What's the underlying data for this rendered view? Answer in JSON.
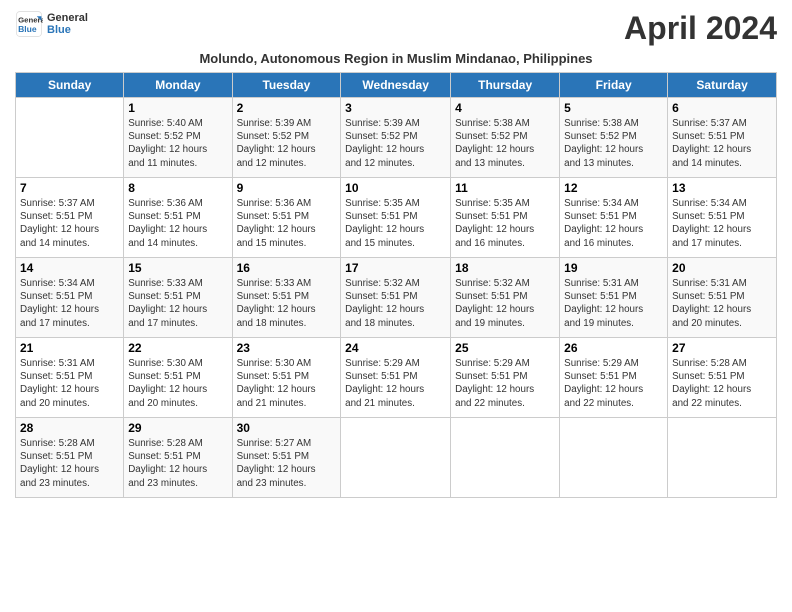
{
  "header": {
    "logo_line1": "General",
    "logo_line2": "Blue",
    "month_title": "April 2024",
    "subtitle": "Molundo, Autonomous Region in Muslim Mindanao, Philippines"
  },
  "weekdays": [
    "Sunday",
    "Monday",
    "Tuesday",
    "Wednesday",
    "Thursday",
    "Friday",
    "Saturday"
  ],
  "weeks": [
    [
      {
        "num": "",
        "info": ""
      },
      {
        "num": "1",
        "info": "Sunrise: 5:40 AM\nSunset: 5:52 PM\nDaylight: 12 hours\nand 11 minutes."
      },
      {
        "num": "2",
        "info": "Sunrise: 5:39 AM\nSunset: 5:52 PM\nDaylight: 12 hours\nand 12 minutes."
      },
      {
        "num": "3",
        "info": "Sunrise: 5:39 AM\nSunset: 5:52 PM\nDaylight: 12 hours\nand 12 minutes."
      },
      {
        "num": "4",
        "info": "Sunrise: 5:38 AM\nSunset: 5:52 PM\nDaylight: 12 hours\nand 13 minutes."
      },
      {
        "num": "5",
        "info": "Sunrise: 5:38 AM\nSunset: 5:52 PM\nDaylight: 12 hours\nand 13 minutes."
      },
      {
        "num": "6",
        "info": "Sunrise: 5:37 AM\nSunset: 5:51 PM\nDaylight: 12 hours\nand 14 minutes."
      }
    ],
    [
      {
        "num": "7",
        "info": "Sunrise: 5:37 AM\nSunset: 5:51 PM\nDaylight: 12 hours\nand 14 minutes."
      },
      {
        "num": "8",
        "info": "Sunrise: 5:36 AM\nSunset: 5:51 PM\nDaylight: 12 hours\nand 14 minutes."
      },
      {
        "num": "9",
        "info": "Sunrise: 5:36 AM\nSunset: 5:51 PM\nDaylight: 12 hours\nand 15 minutes."
      },
      {
        "num": "10",
        "info": "Sunrise: 5:35 AM\nSunset: 5:51 PM\nDaylight: 12 hours\nand 15 minutes."
      },
      {
        "num": "11",
        "info": "Sunrise: 5:35 AM\nSunset: 5:51 PM\nDaylight: 12 hours\nand 16 minutes."
      },
      {
        "num": "12",
        "info": "Sunrise: 5:34 AM\nSunset: 5:51 PM\nDaylight: 12 hours\nand 16 minutes."
      },
      {
        "num": "13",
        "info": "Sunrise: 5:34 AM\nSunset: 5:51 PM\nDaylight: 12 hours\nand 17 minutes."
      }
    ],
    [
      {
        "num": "14",
        "info": "Sunrise: 5:34 AM\nSunset: 5:51 PM\nDaylight: 12 hours\nand 17 minutes."
      },
      {
        "num": "15",
        "info": "Sunrise: 5:33 AM\nSunset: 5:51 PM\nDaylight: 12 hours\nand 17 minutes."
      },
      {
        "num": "16",
        "info": "Sunrise: 5:33 AM\nSunset: 5:51 PM\nDaylight: 12 hours\nand 18 minutes."
      },
      {
        "num": "17",
        "info": "Sunrise: 5:32 AM\nSunset: 5:51 PM\nDaylight: 12 hours\nand 18 minutes."
      },
      {
        "num": "18",
        "info": "Sunrise: 5:32 AM\nSunset: 5:51 PM\nDaylight: 12 hours\nand 19 minutes."
      },
      {
        "num": "19",
        "info": "Sunrise: 5:31 AM\nSunset: 5:51 PM\nDaylight: 12 hours\nand 19 minutes."
      },
      {
        "num": "20",
        "info": "Sunrise: 5:31 AM\nSunset: 5:51 PM\nDaylight: 12 hours\nand 20 minutes."
      }
    ],
    [
      {
        "num": "21",
        "info": "Sunrise: 5:31 AM\nSunset: 5:51 PM\nDaylight: 12 hours\nand 20 minutes."
      },
      {
        "num": "22",
        "info": "Sunrise: 5:30 AM\nSunset: 5:51 PM\nDaylight: 12 hours\nand 20 minutes."
      },
      {
        "num": "23",
        "info": "Sunrise: 5:30 AM\nSunset: 5:51 PM\nDaylight: 12 hours\nand 21 minutes."
      },
      {
        "num": "24",
        "info": "Sunrise: 5:29 AM\nSunset: 5:51 PM\nDaylight: 12 hours\nand 21 minutes."
      },
      {
        "num": "25",
        "info": "Sunrise: 5:29 AM\nSunset: 5:51 PM\nDaylight: 12 hours\nand 22 minutes."
      },
      {
        "num": "26",
        "info": "Sunrise: 5:29 AM\nSunset: 5:51 PM\nDaylight: 12 hours\nand 22 minutes."
      },
      {
        "num": "27",
        "info": "Sunrise: 5:28 AM\nSunset: 5:51 PM\nDaylight: 12 hours\nand 22 minutes."
      }
    ],
    [
      {
        "num": "28",
        "info": "Sunrise: 5:28 AM\nSunset: 5:51 PM\nDaylight: 12 hours\nand 23 minutes."
      },
      {
        "num": "29",
        "info": "Sunrise: 5:28 AM\nSunset: 5:51 PM\nDaylight: 12 hours\nand 23 minutes."
      },
      {
        "num": "30",
        "info": "Sunrise: 5:27 AM\nSunset: 5:51 PM\nDaylight: 12 hours\nand 23 minutes."
      },
      {
        "num": "",
        "info": ""
      },
      {
        "num": "",
        "info": ""
      },
      {
        "num": "",
        "info": ""
      },
      {
        "num": "",
        "info": ""
      }
    ]
  ]
}
